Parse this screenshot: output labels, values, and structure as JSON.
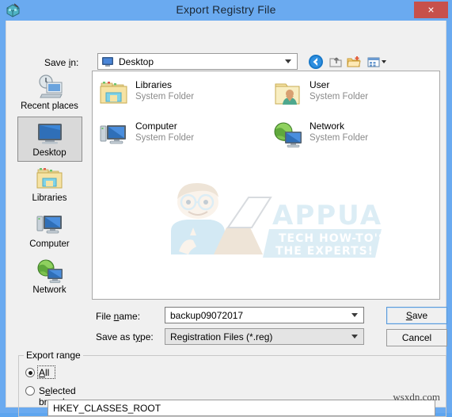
{
  "window": {
    "title": "Export Registry File",
    "icon": "registry-editor-icon",
    "close_label": "×",
    "titlebar_color": "#6aaaf0",
    "close_color": "#c7504b"
  },
  "toolbar": {
    "save_in_label": "Save in:",
    "save_in_value": "Desktop",
    "buttons": [
      {
        "name": "back-icon",
        "label": "Back"
      },
      {
        "name": "up-one-level-icon",
        "label": "Up One Level"
      },
      {
        "name": "new-folder-icon",
        "label": "Create New Folder"
      },
      {
        "name": "views-icon",
        "label": "Views"
      }
    ]
  },
  "places": [
    {
      "label": "Recent places",
      "icon": "recent-places-icon",
      "selected": false
    },
    {
      "label": "Desktop",
      "icon": "desktop-icon",
      "selected": true
    },
    {
      "label": "Libraries",
      "icon": "libraries-icon",
      "selected": false
    },
    {
      "label": "Computer",
      "icon": "computer-icon",
      "selected": false
    },
    {
      "label": "Network",
      "icon": "network-icon",
      "selected": false
    }
  ],
  "files": [
    {
      "name": "Libraries",
      "type": "System Folder",
      "icon": "libraries-folder-icon"
    },
    {
      "name": "User",
      "type": "System Folder",
      "icon": "user-folder-icon"
    },
    {
      "name": "Computer",
      "type": "System Folder",
      "icon": "computer-icon"
    },
    {
      "name": "Network",
      "type": "System Folder",
      "icon": "network-icon"
    }
  ],
  "watermark": {
    "brand": "APPUALS",
    "tagline_line1": "TECH HOW-TO'S FROM",
    "tagline_line2": "THE EXPERTS!",
    "footer": "wsxdn.com"
  },
  "form": {
    "file_name_label": "File name:",
    "file_name_value": "backup09072017",
    "save_as_type_label": "Save as type:",
    "save_as_type_value": "Registration Files (*.reg)",
    "save_button": "Save",
    "cancel_button": "Cancel"
  },
  "export_range": {
    "title": "Export range",
    "option_all": "All",
    "option_selected_branch": "Selected branch",
    "selected": "all",
    "branch_value": "HKEY_CLASSES_ROOT"
  }
}
